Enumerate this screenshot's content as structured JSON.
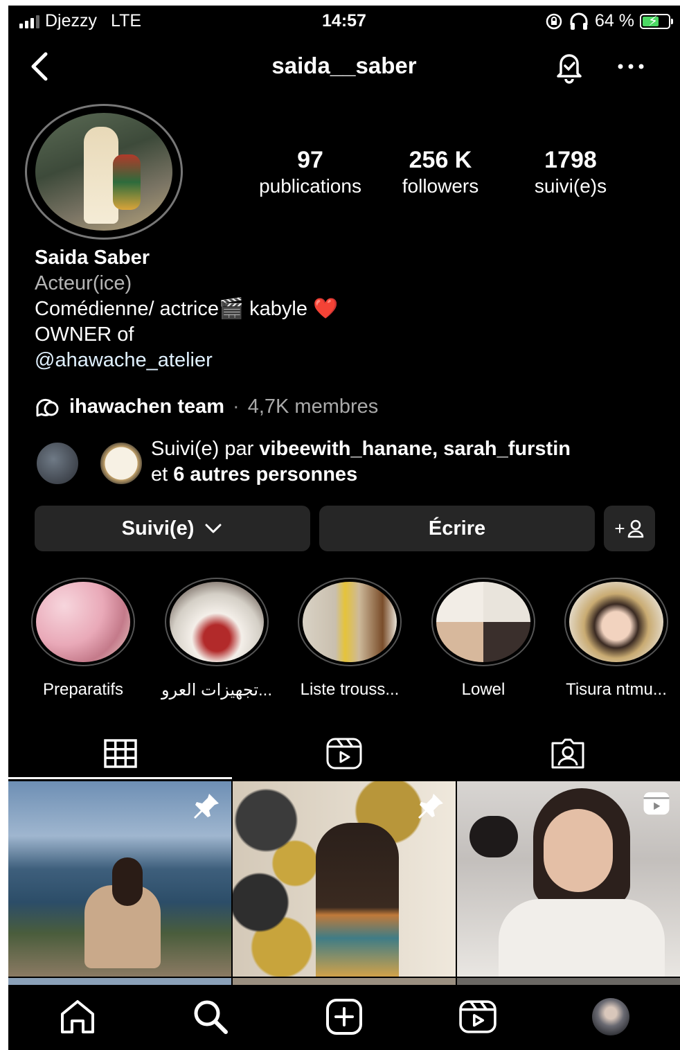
{
  "status_bar": {
    "carrier": "Djezzy",
    "network": "LTE",
    "time": "14:57",
    "battery": "64 %",
    "battery_level": 0.64
  },
  "header": {
    "username": "saida__saber"
  },
  "stats": [
    {
      "value": "97",
      "label": "publications"
    },
    {
      "value": "256 K",
      "label": "followers"
    },
    {
      "value": "1798",
      "label": "suivi(e)s"
    }
  ],
  "bio": {
    "name": "Saida Saber",
    "category": "Acteur(ice)",
    "line1_a": "Comédienne/ actrice",
    "line1_emoji": "🎬",
    "line1_b": " kabyle ",
    "line1_heart": "❤️",
    "line2": "OWNER of",
    "mention": "@ahawache_atelier"
  },
  "channel": {
    "name": "ihawachen team",
    "separator": "·",
    "members": "4,7K membres"
  },
  "followed_by": {
    "prefix": "Suivi(e) par ",
    "users": "vibeewith_hanane, sarah_furstin",
    "line2_prefix": "et ",
    "others": "6 autres personnes"
  },
  "buttons": {
    "following": "Suivi(e)",
    "message": "Écrire",
    "add_person": "+"
  },
  "highlights": [
    {
      "label": "Preparatifs"
    },
    {
      "label": "تجهيزات العرو..."
    },
    {
      "label": "Liste trouss..."
    },
    {
      "label": "Lowel"
    },
    {
      "label": "Tisura ntmu..."
    }
  ],
  "tabs": [
    {
      "icon": "grid-icon"
    },
    {
      "icon": "reels-icon"
    },
    {
      "icon": "tagged-icon"
    }
  ],
  "posts": [
    {
      "badge": "pin-icon"
    },
    {
      "badge": "pin-icon"
    },
    {
      "badge": "reels-icon"
    }
  ],
  "nav": [
    {
      "icon": "home-icon"
    },
    {
      "icon": "search-icon"
    },
    {
      "icon": "create-icon"
    },
    {
      "icon": "reels-icon"
    },
    {
      "icon": "profile-avatar"
    }
  ],
  "colors": {
    "background": "#000000",
    "button": "#262626",
    "heart": "#e0245e",
    "battery": "#4cd964"
  }
}
